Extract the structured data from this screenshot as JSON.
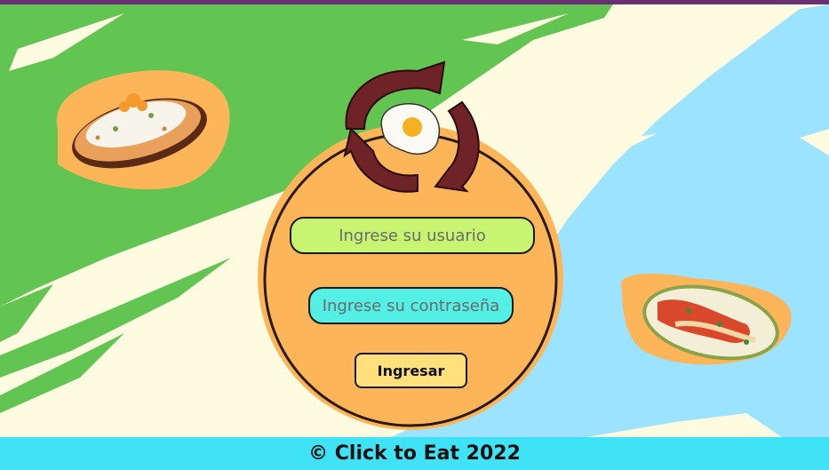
{
  "login": {
    "username_placeholder": "Ingrese su usuario",
    "password_placeholder": "Ingrese su contraseña",
    "submit_label": "Ingresar"
  },
  "footer": {
    "text": "© Click to Eat 2022"
  },
  "icons": [
    "refresh-egg-logo-icon",
    "rice-dish-icon",
    "enchiladas-dish-icon"
  ],
  "colors": {
    "top_bar": "#6b2f73",
    "green_stroke": "#62c552",
    "blue_stroke": "#9be3ff",
    "cream": "#fdfbe0",
    "orange_circle": "#fdb55a",
    "username_field": "#c8f571",
    "password_field": "#54f0e6",
    "submit_button": "#ffe07a",
    "footer_bar": "#3fe3f5",
    "logo_arrows": "#6e2327"
  }
}
